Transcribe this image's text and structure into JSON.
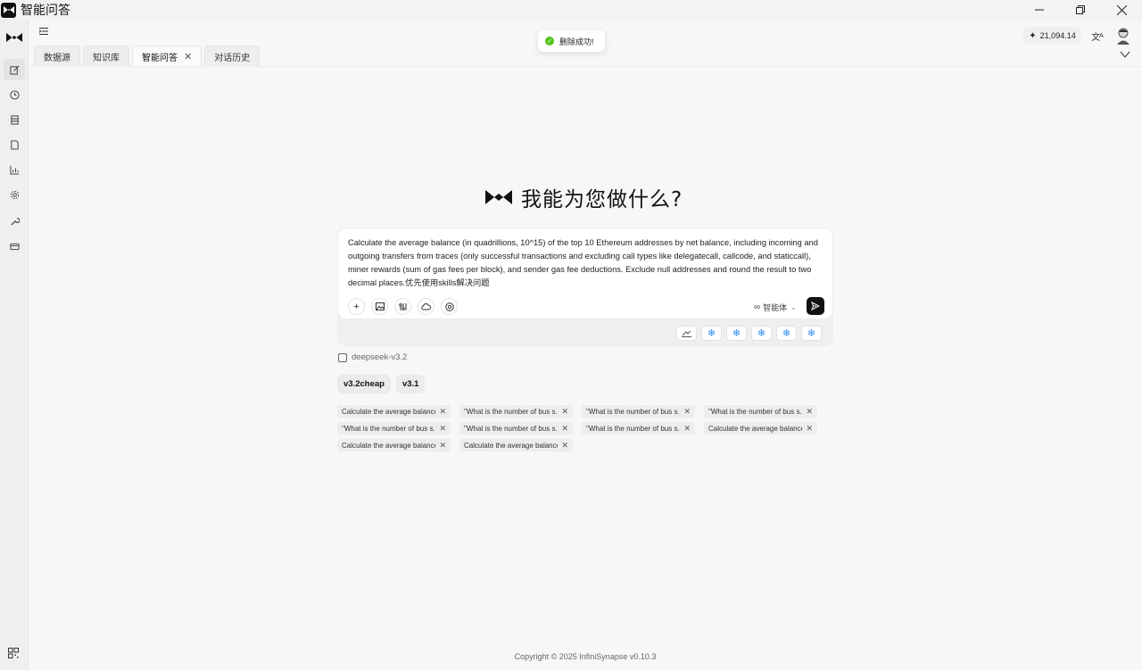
{
  "window": {
    "title": "智能问答"
  },
  "sidebar": {
    "items": [
      {
        "name": "edit-icon"
      },
      {
        "name": "history-icon"
      },
      {
        "name": "database-icon"
      },
      {
        "name": "document-icon"
      },
      {
        "name": "chart-icon"
      },
      {
        "name": "settings-icon"
      },
      {
        "name": "tool-icon"
      },
      {
        "name": "card-icon"
      }
    ]
  },
  "tabs": [
    {
      "label": "数据源"
    },
    {
      "label": "知识库"
    },
    {
      "label": "智能问答",
      "active": true
    },
    {
      "label": "对话历史"
    }
  ],
  "toast": {
    "text": "删除成功!"
  },
  "credits": {
    "value": "21,094.14"
  },
  "hero": {
    "title": "我能为您做什么?"
  },
  "input": {
    "text": "Calculate the average balance (in quadrillions, 10^15) of the top 10 Ethereum addresses by net balance, including incoming and outgoing transfers from traces (only successful transactions and excluding call types like delegatecall, callcode, and staticcall), miner rewards (sum of gas fees per block), and sender gas fee deductions. Exclude null addresses and round the result to two decimal places.优先使用skills解决问题",
    "agent_label": "智能体"
  },
  "model": {
    "label": "deepseek-v3.2"
  },
  "versions": [
    "v3.2cheap",
    "v3.1"
  ],
  "history": [
    "Calculate the average balance...",
    "\"What is the number of bus s...",
    "\"What is the number of bus s...",
    "\"What is the number of bus s...",
    "\"What is the number of bus s...",
    "\"What is the number of bus s...",
    "\"What is the number of bus s...",
    "Calculate the average balance...",
    "Calculate the average balance...",
    "Calculate the average balance..."
  ],
  "footer": {
    "text": "Copyright © 2025 InfiniSynapse v0.10.3"
  },
  "colors": {
    "accent": "#111111",
    "snowflake": "#2d8cf0",
    "success": "#52c41a"
  }
}
